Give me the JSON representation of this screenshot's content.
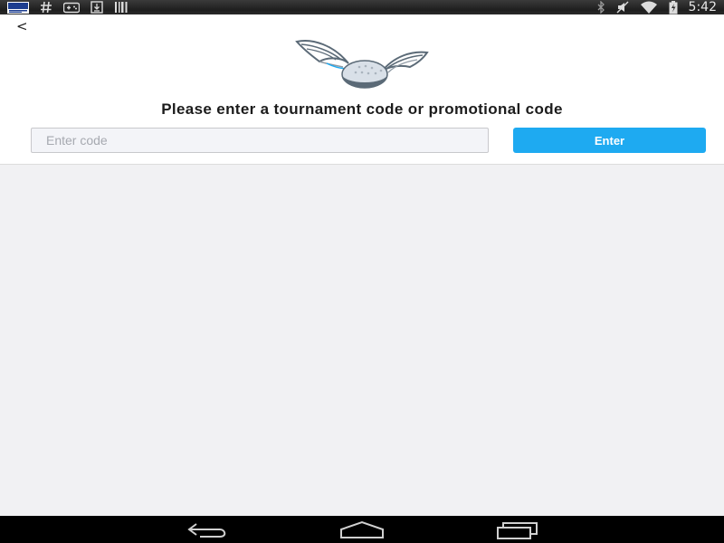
{
  "status_bar": {
    "time": "5:42",
    "left_icons": [
      "news-app-icon",
      "hash-icon",
      "game-controller-icon",
      "download-icon",
      "barcode-icon"
    ],
    "right_icons": [
      "bluetooth-icon",
      "mute-icon",
      "wifi-icon",
      "battery-charging-icon"
    ]
  },
  "header": {
    "back_label": "<",
    "prompt": "Please enter a tournament code or promotional code"
  },
  "code_form": {
    "placeholder": "Enter code",
    "value": "",
    "enter_label": "Enter"
  },
  "colors": {
    "accent": "#1eaaf1",
    "background": "#f1f1f3",
    "header_bg": "#ffffff",
    "logo_ball": "#d9e0e8",
    "logo_wing": "#5b6a77"
  },
  "nav_bar": {
    "buttons": [
      "back-nav-icon",
      "home-nav-icon",
      "recents-nav-icon"
    ]
  }
}
